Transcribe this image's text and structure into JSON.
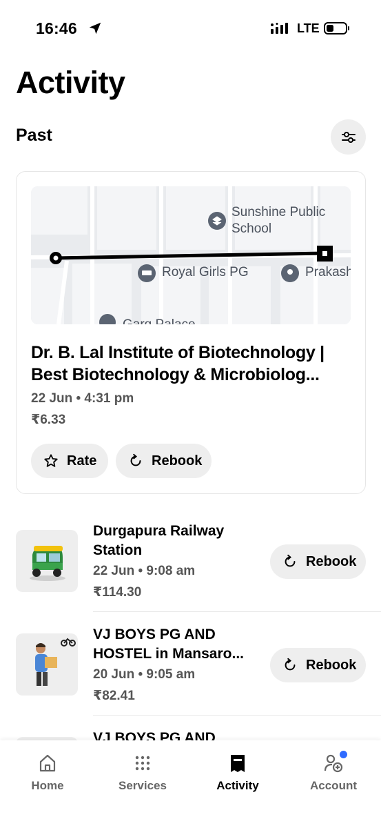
{
  "status_bar": {
    "time": "16:46",
    "network": "LTE"
  },
  "header": {
    "title": "Activity",
    "section": "Past"
  },
  "featured": {
    "map": {
      "labels": [
        "Sunshine Public",
        "School",
        "Royal Girls PG",
        "Prakash",
        "Garg Palace"
      ]
    },
    "title": "Dr. B. Lal Institute of Biotechnology | Best Biotechnology & Microbiolog...",
    "date": "22 Jun • 4:31 pm",
    "price": "₹6.33",
    "rate_label": "Rate",
    "rebook_label": "Rebook"
  },
  "trips": [
    {
      "title": "Durgapura Railway Station",
      "date": "22 Jun • 9:08 am",
      "price": "₹114.30",
      "rebook_label": "Rebook",
      "thumb": "auto-rickshaw"
    },
    {
      "title": "VJ BOYS PG AND HOSTEL in Mansaro...",
      "date": "20 Jun • 9:05 am",
      "price": "₹82.41",
      "rebook_label": "Rebook",
      "thumb": "delivery-person"
    },
    {
      "title": "VJ BOYS PG AND"
    }
  ],
  "tab_bar": {
    "tabs": [
      {
        "label": "Home",
        "icon": "home-icon"
      },
      {
        "label": "Services",
        "icon": "grid-icon"
      },
      {
        "label": "Activity",
        "icon": "receipt-icon",
        "active": true
      },
      {
        "label": "Account",
        "icon": "account-icon"
      }
    ]
  },
  "colors": {
    "accent": "#2f6bff",
    "pill": "#eeeeee",
    "muted_text": "#555555"
  }
}
